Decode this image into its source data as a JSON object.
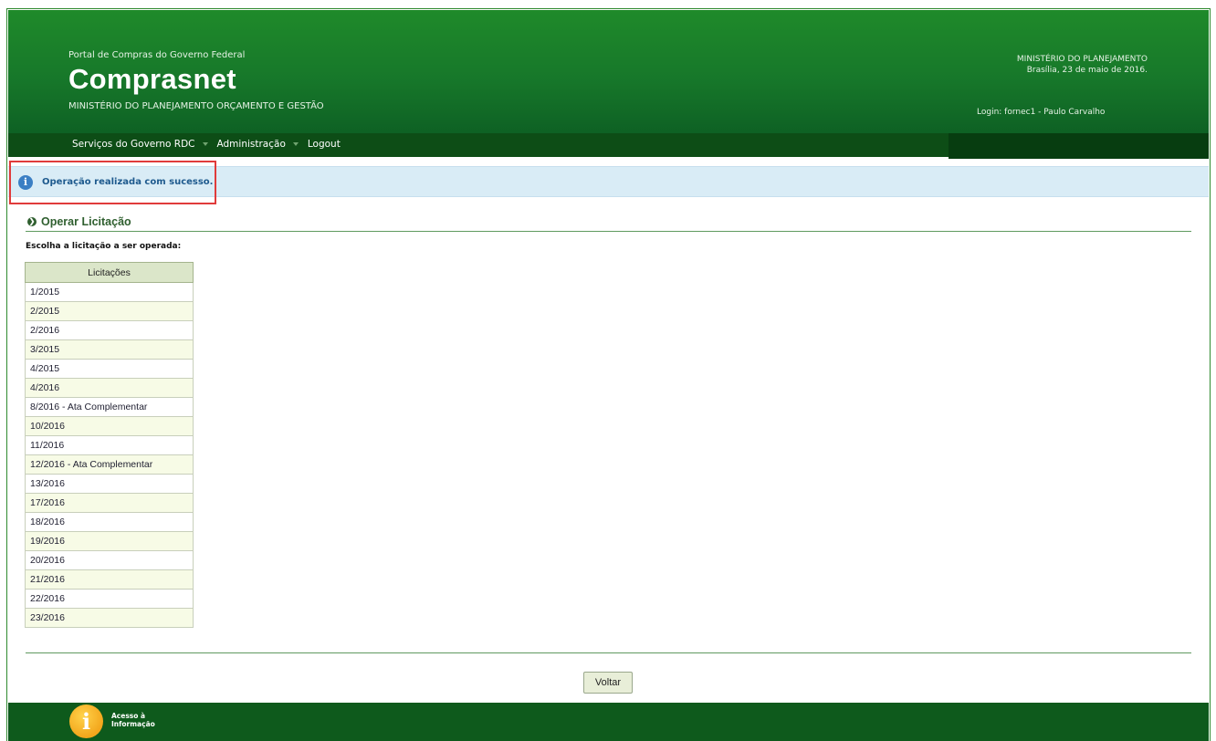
{
  "header": {
    "portal_line": "Portal de Compras do Governo Federal",
    "brand": "Comprasnet",
    "ministry_sub": "MINISTÉRIO DO PLANEJAMENTO ORÇAMENTO E GESTÃO",
    "ministry_right": "MINISTÉRIO DO PLANEJAMENTO",
    "date": "Brasília, 23 de maio de 2016.",
    "login": "Login: fornec1 - Paulo Carvalho"
  },
  "menu": {
    "items": [
      "Serviços do Governo RDC",
      "Administração",
      "Logout"
    ]
  },
  "alert": {
    "message": "Operação realizada com sucesso."
  },
  "section": {
    "title": "Operar Licitação",
    "subtitle": "Escolha a licitação a ser operada:"
  },
  "table": {
    "header": "Licitações",
    "rows": [
      "1/2015",
      "2/2015",
      "2/2016",
      "3/2015",
      "4/2015",
      "4/2016",
      "8/2016 - Ata Complementar",
      "10/2016",
      "11/2016",
      "12/2016 - Ata Complementar",
      "13/2016",
      "17/2016",
      "18/2016",
      "19/2016",
      "20/2016",
      "21/2016",
      "22/2016",
      "23/2016"
    ]
  },
  "buttons": {
    "voltar": "Voltar"
  },
  "footer": {
    "acesso_line1": "Acesso à",
    "acesso_line2": "Informação"
  },
  "colors": {
    "header_green": "#1f8a2a",
    "menubar": "#0d4d16",
    "alert_bg": "#d9ecf6",
    "alert_text": "#1e5a8e",
    "highlight_border": "#e03b3b"
  }
}
